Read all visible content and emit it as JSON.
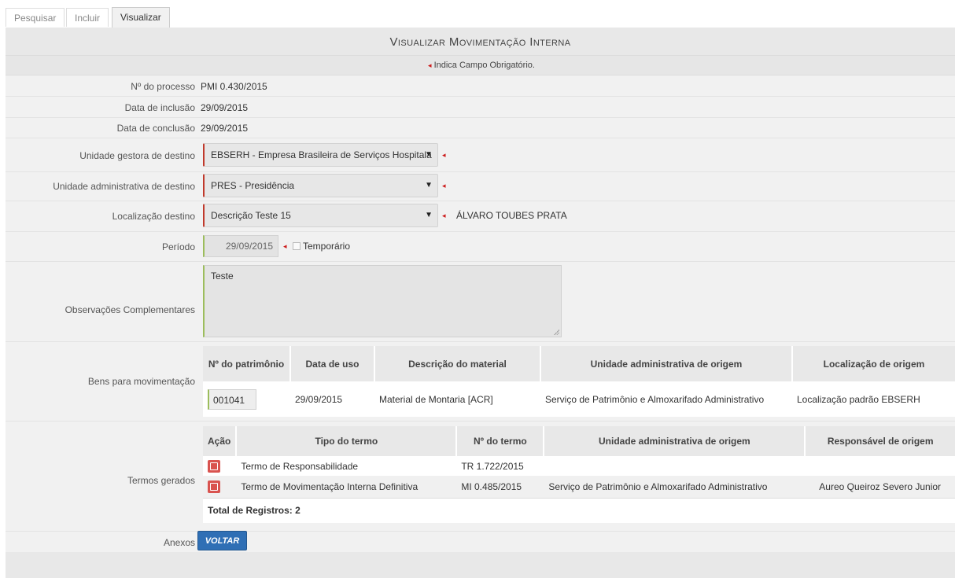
{
  "tabs": [
    "Pesquisar",
    "Incluir",
    "Visualizar"
  ],
  "title": "Visualizar Movimentação Interna",
  "hint": "Indica Campo Obrigatório.",
  "fields": {
    "processo_label": "Nº do processo",
    "processo_value": "PMI 0.430/2015",
    "inclusao_label": "Data de inclusão",
    "inclusao_value": "29/09/2015",
    "conclusao_label": "Data de conclusão",
    "conclusao_value": "29/09/2015",
    "unidade_gestora_label": "Unidade gestora de destino",
    "unidade_gestora_value": "EBSERH - Empresa Brasileira de Serviços Hospitala",
    "unidade_admin_label": "Unidade administrativa de destino",
    "unidade_admin_value": "PRES - Presidência",
    "localizacao_label": "Localização destino",
    "localizacao_value": "Descrição Teste 15",
    "localizacao_resp": "ÁLVARO TOUBES PRATA",
    "periodo_label": "Período",
    "periodo_value": "29/09/2015",
    "temporario_label": "Temporário",
    "observacoes_label": "Observações Complementares",
    "observacoes_value": "Teste",
    "bens_label": "Bens para movimentação",
    "termos_label": "Termos gerados",
    "anexos_label": "Anexos"
  },
  "bens_table": {
    "headers": [
      "Nº do patrimônio",
      "Data de uso",
      "Descrição do material",
      "Unidade administrativa de origem",
      "Localização de origem"
    ],
    "rows": [
      [
        "001041",
        "29/09/2015",
        "Material de Montaria [ACR]",
        "Serviço de Patrimônio e Almoxarifado Administrativo",
        "Localização padrão EBSERH"
      ]
    ]
  },
  "termos_table": {
    "headers": [
      "Ação",
      "Tipo do termo",
      "Nº do termo",
      "Unidade administrativa de origem",
      "Responsável de origem"
    ],
    "rows": [
      [
        "pdf-icon",
        "Termo de Responsabilidade",
        "TR 1.722/2015",
        "",
        ""
      ],
      [
        "pdf-icon",
        "Termo de Movimentação Interna Definitiva",
        "MI 0.485/2015",
        "Serviço de Patrimônio e Almoxarifado Administrativo",
        "Aureo Queiroz Severo Junior"
      ]
    ],
    "total": "Total de Registros: 2"
  },
  "button_voltar": "VOLTAR",
  "colors": {
    "required": "#cc1a1a",
    "button": "#2f6fb5",
    "panel": "#f1f1f1"
  }
}
